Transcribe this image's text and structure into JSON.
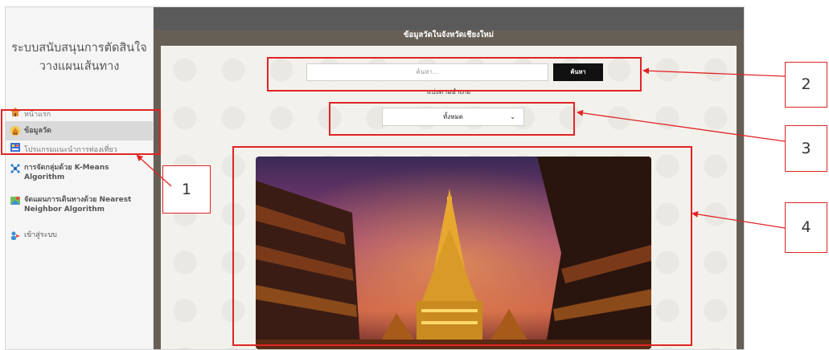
{
  "sidebar": {
    "title_line1": "ระบบสนับสนุนการตัดสินใจ",
    "title_line2": "วางแผนเส้นทาง",
    "items": [
      {
        "label": "หน้าแรก"
      },
      {
        "label": "ข้อมูลวัด"
      },
      {
        "label": "โปรแกรมแนะนำการท่องเที่ยว"
      },
      {
        "label": "การจัดกลุ่มด้วย K-Means Algorithm"
      },
      {
        "label": "จัดแผนการเดินทางด้วย Nearest Neighbor Algorithm"
      },
      {
        "label": "เข้าสู่ระบบ"
      }
    ]
  },
  "main": {
    "title": "ข้อมูลวัดในจังหวัดเชียงใหม่",
    "search": {
      "placeholder": "ค้นหา...",
      "button_label": "ค้นหา"
    },
    "filter": {
      "label": "แบ่งตามอำเภอ",
      "selected": "ทั้งหมด"
    }
  },
  "callouts": {
    "one": "1",
    "two": "2",
    "three": "3",
    "four": "4"
  },
  "colors": {
    "callout": "#e02424",
    "header": "#5a5a5a",
    "selected_item": "#d9d9d9",
    "button": "#111111"
  }
}
